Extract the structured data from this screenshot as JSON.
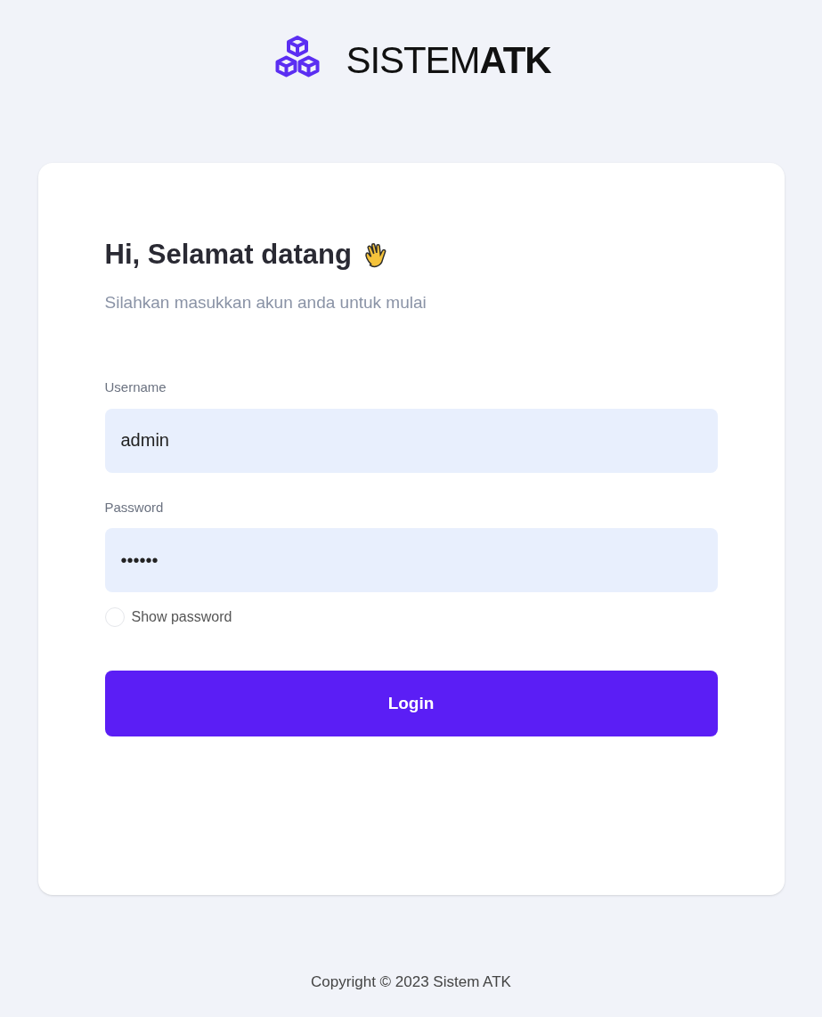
{
  "brand": {
    "name": "SISTEM**ATK**"
  },
  "card": {
    "title": "Hi, Selamat datang",
    "subtitle": "Silahkan masukkan akun anda untuk mulai",
    "fields": [
      {
        "label": "Username",
        "value": "admin"
      },
      {
        "label": "Password",
        "value": "••••••"
      }
    ],
    "show_password": {
      "label": "Show password",
      "checked": false
    },
    "button": "Login"
  },
  "footer": "Copyright © 2023 Sistem ATK"
}
